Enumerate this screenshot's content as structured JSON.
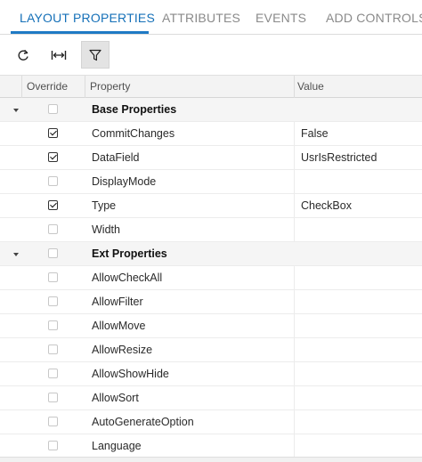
{
  "tabs": [
    {
      "label": "LAYOUT PROPERTIES",
      "active": true
    },
    {
      "label": "ATTRIBUTES",
      "active": false
    },
    {
      "label": "EVENTS",
      "active": false
    },
    {
      "label": "ADD CONTROLS",
      "active": false
    }
  ],
  "toolbar": {
    "buttons": [
      {
        "icon": "refresh-icon",
        "active": false
      },
      {
        "icon": "fit-width-icon",
        "active": false
      },
      {
        "icon": "filter-icon",
        "active": true
      }
    ]
  },
  "grid": {
    "headers": {
      "override": "Override",
      "property": "Property",
      "value": "Value"
    },
    "rows": [
      {
        "type": "group",
        "expanded": true,
        "checked": false,
        "property": "Base Properties",
        "value": ""
      },
      {
        "type": "item",
        "checked": true,
        "property": "CommitChanges",
        "value": "False"
      },
      {
        "type": "item",
        "checked": true,
        "property": "DataField",
        "value": "UsrIsRestricted"
      },
      {
        "type": "item",
        "checked": false,
        "property": "DisplayMode",
        "value": ""
      },
      {
        "type": "item",
        "checked": true,
        "property": "Type",
        "value": "CheckBox"
      },
      {
        "type": "item",
        "checked": false,
        "property": "Width",
        "value": ""
      },
      {
        "type": "group",
        "expanded": true,
        "checked": false,
        "property": "Ext Properties",
        "value": ""
      },
      {
        "type": "item",
        "checked": false,
        "property": "AllowCheckAll",
        "value": ""
      },
      {
        "type": "item",
        "checked": false,
        "property": "AllowFilter",
        "value": ""
      },
      {
        "type": "item",
        "checked": false,
        "property": "AllowMove",
        "value": ""
      },
      {
        "type": "item",
        "checked": false,
        "property": "AllowResize",
        "value": ""
      },
      {
        "type": "item",
        "checked": false,
        "property": "AllowShowHide",
        "value": ""
      },
      {
        "type": "item",
        "checked": false,
        "property": "AllowSort",
        "value": ""
      },
      {
        "type": "item",
        "checked": false,
        "property": "AutoGenerateOption",
        "value": ""
      },
      {
        "type": "item",
        "checked": false,
        "property": "Language",
        "value": ""
      }
    ]
  },
  "colors": {
    "accent": "#1f7ac4",
    "tab_inactive": "#8a8a8a",
    "header_bg": "#f3f3f3"
  }
}
